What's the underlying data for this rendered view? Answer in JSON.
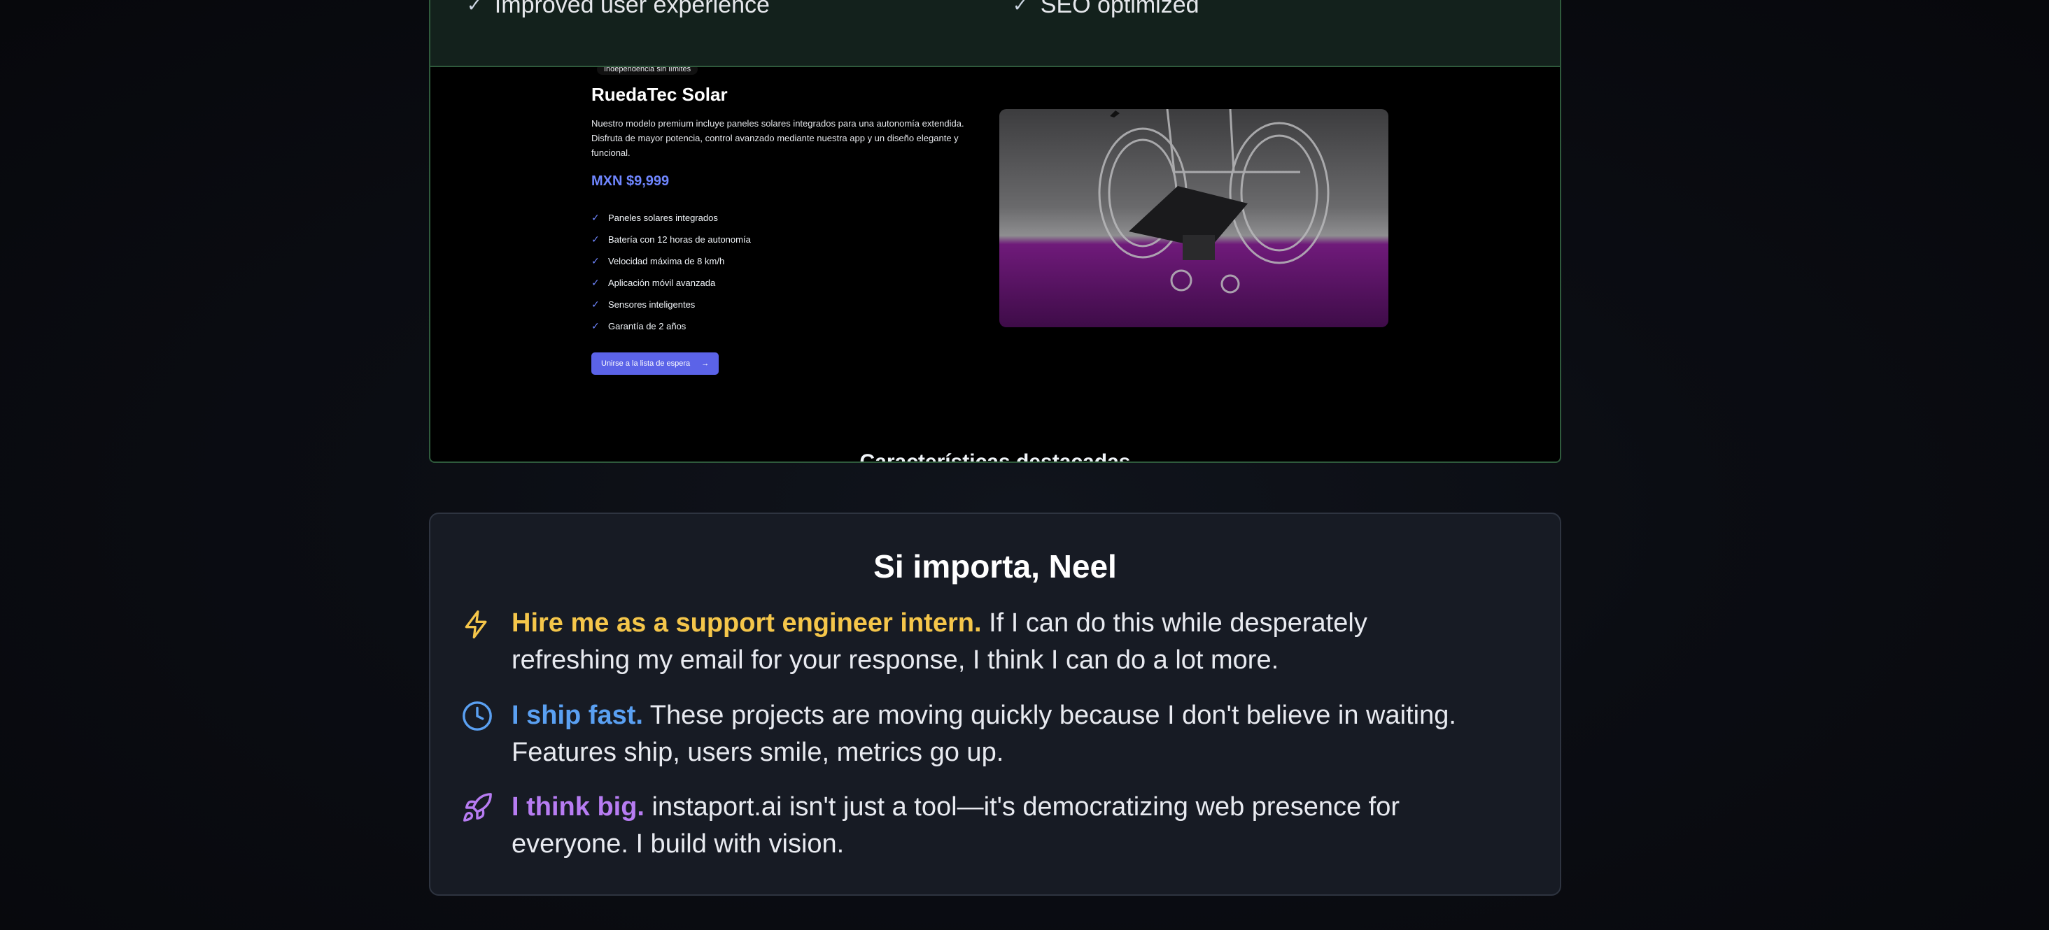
{
  "top_features": [
    {
      "label": "Improved user experience"
    },
    {
      "label": "SEO optimized"
    }
  ],
  "preview": {
    "eyebrow": "Independencia sin límites",
    "title": "RuedaTec Solar",
    "description": "Nuestro modelo premium incluye paneles solares integrados para una autonomía extendida. Disfruta de mayor potencia, control avanzado mediante nuestra app y un diseño elegante y funcional.",
    "price": "MXN $9,999",
    "features": [
      "Paneles solares integrados",
      "Batería con 12 horas de autonomía",
      "Velocidad máxima de 8 km/h",
      "Aplicación móvil avanzada",
      "Sensores inteligentes",
      "Garantía de 2 años"
    ],
    "cta_label": "Unirse a la lista de espera",
    "next_section_title": "Características destacadas"
  },
  "pitch": {
    "title": "Si importa, Neel",
    "points": [
      {
        "icon": "lightning-icon",
        "color": "#f5c64a",
        "highlight": "Hire me as a support engineer intern.",
        "text": " If I can do this while desperately refreshing my email for your response, I think I can do a lot more."
      },
      {
        "icon": "clock-icon",
        "color": "#5aa0f2",
        "highlight": "I ship fast.",
        "text": " These projects are moving quickly because I don't believe in waiting. Features ship, users smile, metrics go up."
      },
      {
        "icon": "rocket-icon",
        "color": "#b77cf2",
        "highlight": "I think big.",
        "text": " instaport.ai isn't just a tool—it's democratizing web presence for everyone. I build with vision."
      }
    ]
  }
}
